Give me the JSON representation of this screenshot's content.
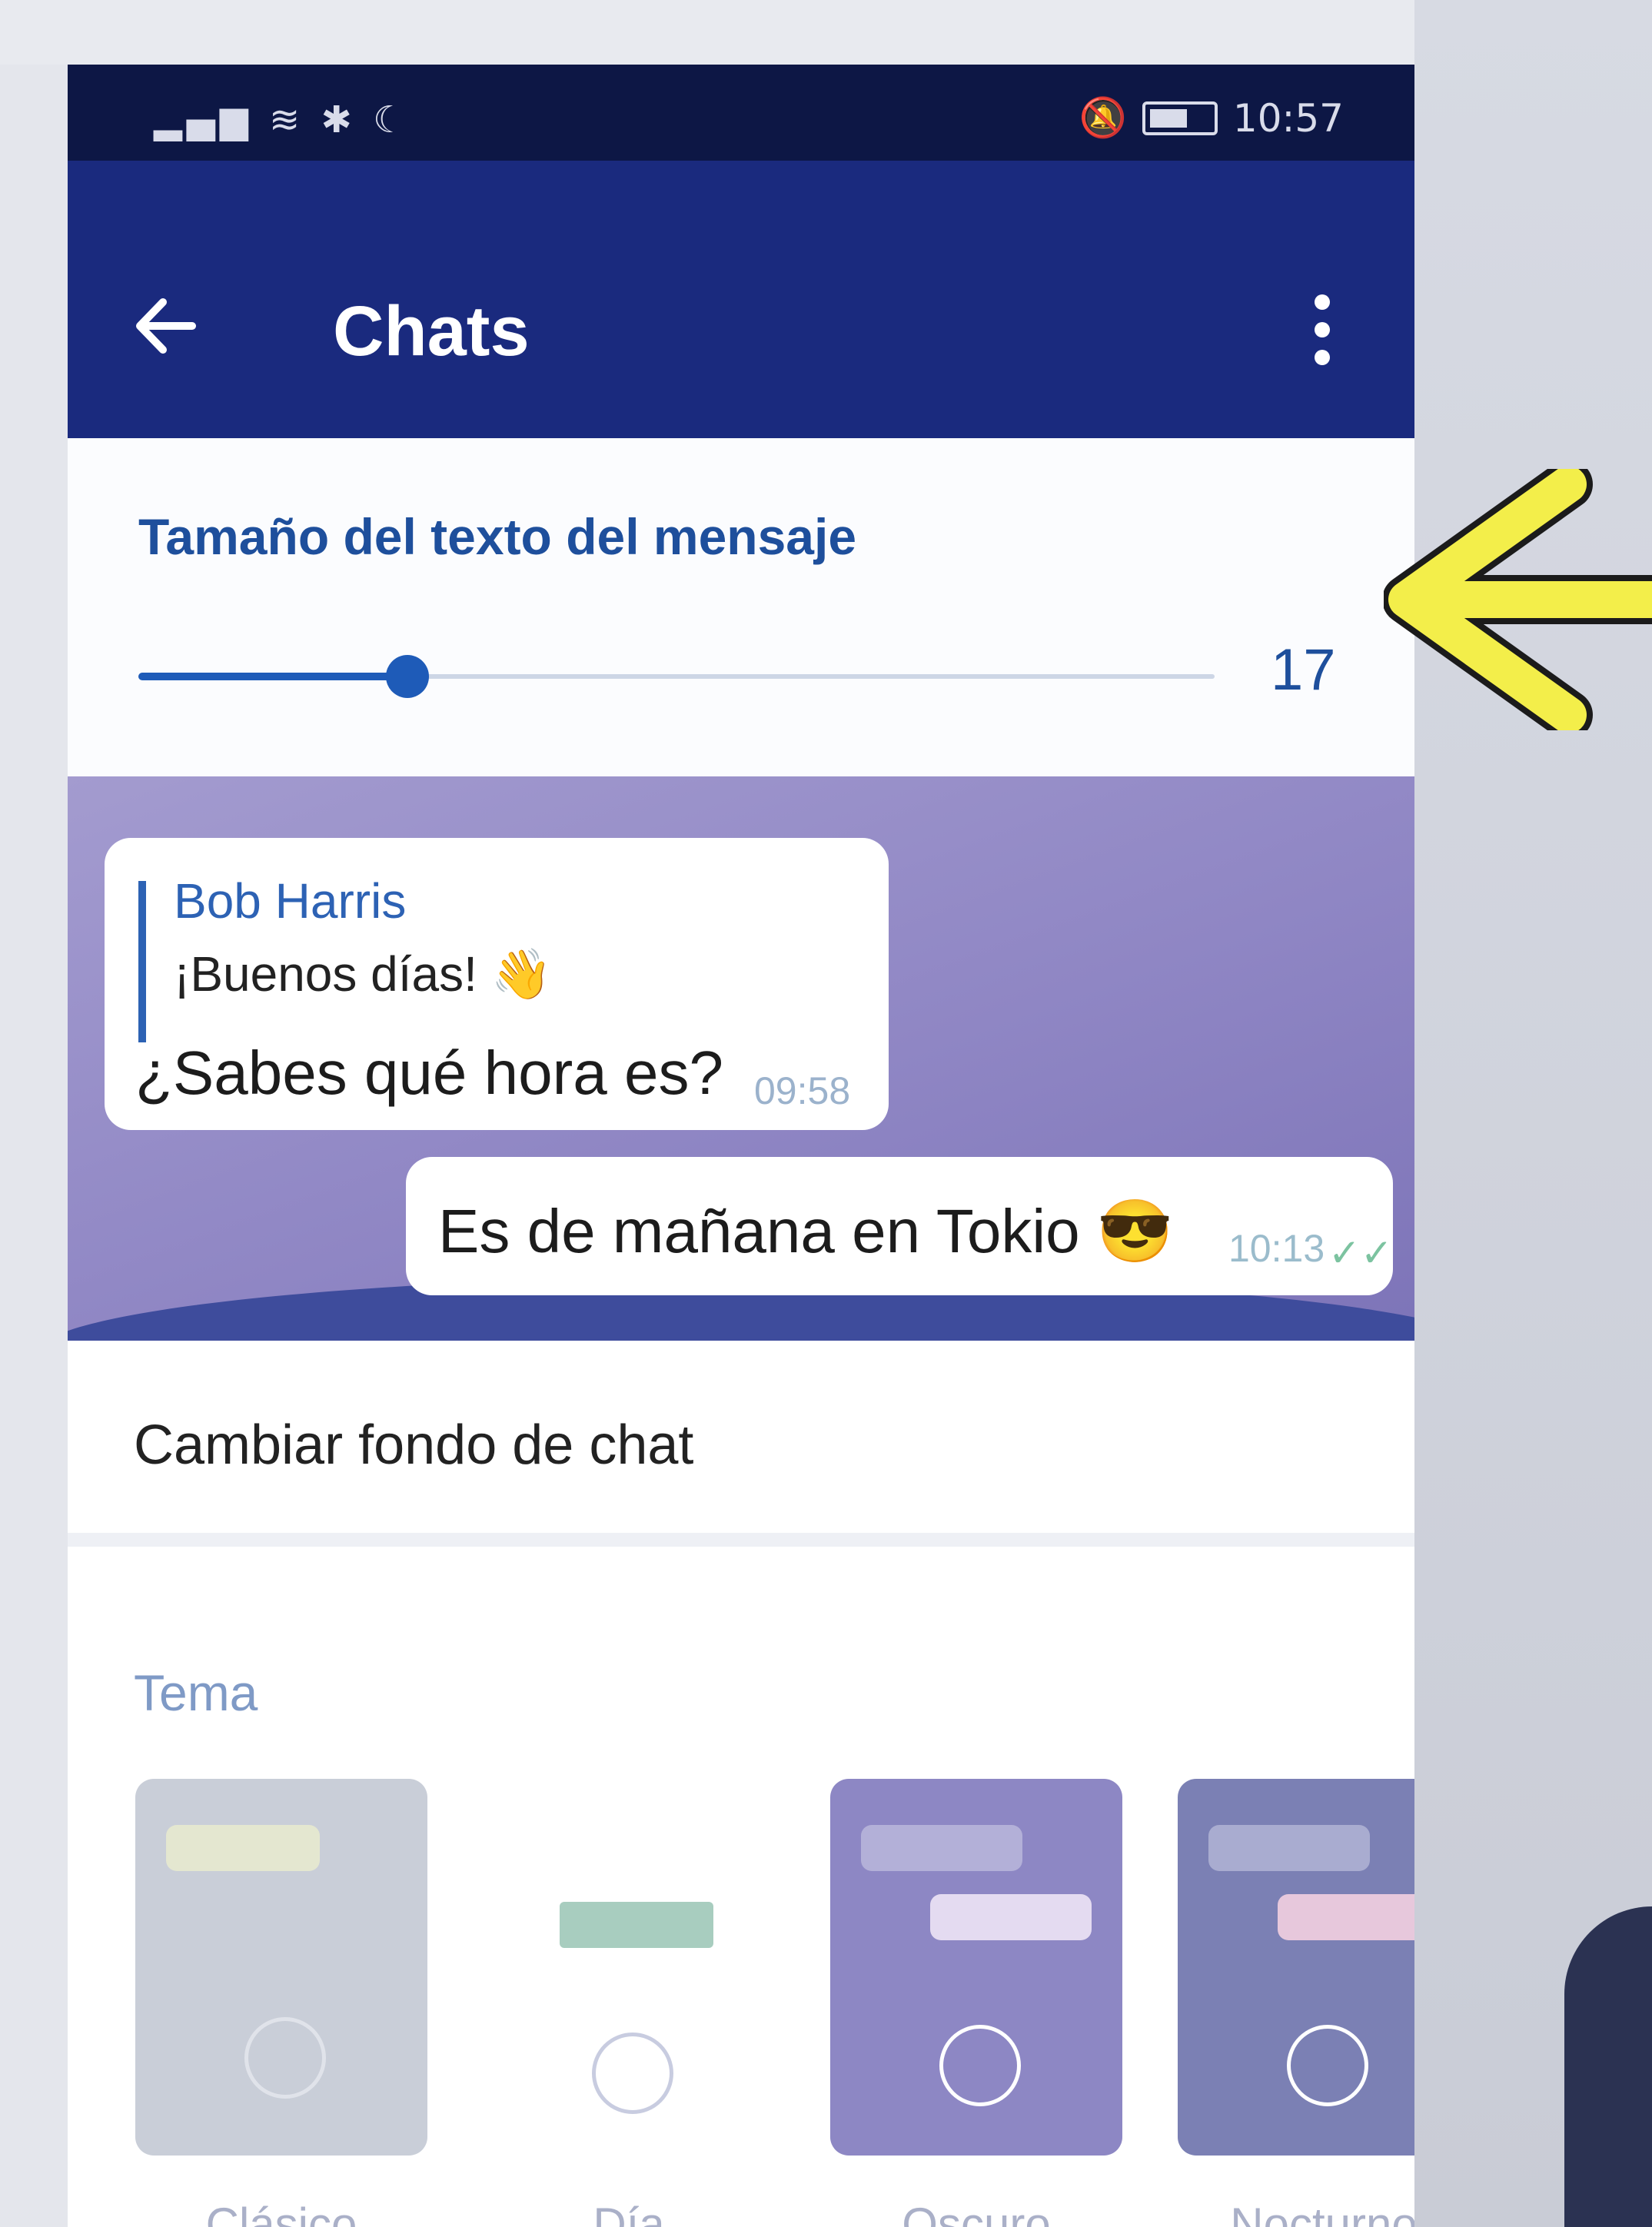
{
  "status_bar": {
    "left_icons": "signal wifi bluetooth moon",
    "time": "10:57"
  },
  "header": {
    "title": "Chats"
  },
  "text_size": {
    "label": "Tamaño del texto del mensaje",
    "value": "17",
    "slider_fraction": 0.25
  },
  "preview": {
    "reply_name": "Bob Harris",
    "reply_text": "¡Buenos días! 👋",
    "incoming_message": "¿Sabes qué hora es?",
    "incoming_time": "09:58",
    "outgoing_message": "Es de mañana en Tokio 😎",
    "outgoing_time": "10:13"
  },
  "settings": {
    "change_background": "Cambiar fondo de chat",
    "theme_heading": "Tema"
  },
  "themes": [
    {
      "label": "Clásico",
      "color": "#c9ced8"
    },
    {
      "label": "Día",
      "color": "#ffffff"
    },
    {
      "label": "Oscuro",
      "color": "#8d87c4"
    },
    {
      "label": "Nocturno",
      "color": "#7b80b4"
    }
  ],
  "colors": {
    "header": "#1a2a7e",
    "status_bar": "#0d1745",
    "accent": "#1e5bb8",
    "annotation_arrow": "#f3ee4a"
  }
}
